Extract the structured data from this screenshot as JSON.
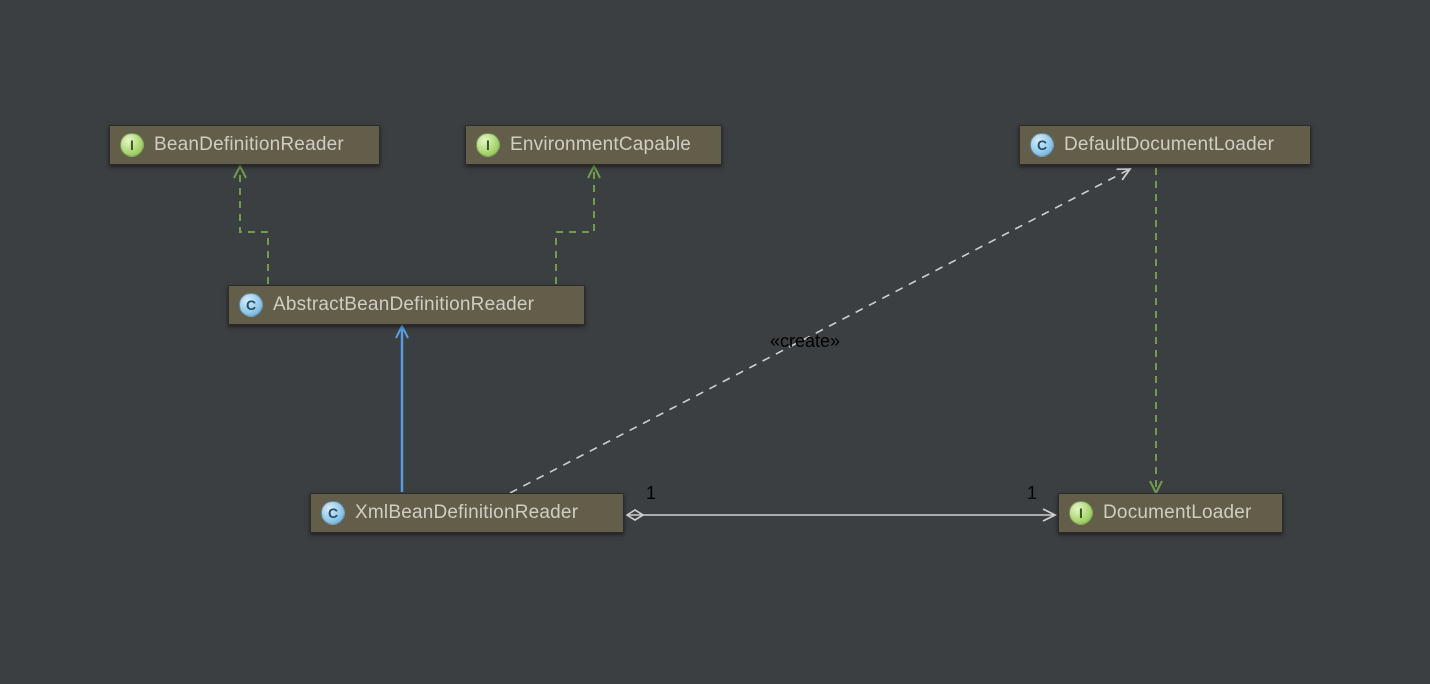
{
  "nodes": {
    "beanDefinitionReader": {
      "type": "interface",
      "label": "BeanDefinitionReader"
    },
    "environmentCapable": {
      "type": "interface",
      "label": "EnvironmentCapable"
    },
    "abstractBeanDefinitionReader": {
      "type": "class",
      "label": "AbstractBeanDefinitionReader"
    },
    "xmlBeanDefinitionReader": {
      "type": "class",
      "label": "XmlBeanDefinitionReader"
    },
    "defaultDocumentLoader": {
      "type": "class",
      "label": "DefaultDocumentLoader"
    },
    "documentLoader": {
      "type": "interface",
      "label": "DocumentLoader"
    }
  },
  "icons": {
    "interface": "I",
    "class": "C"
  },
  "relationships": {
    "create_stereotype": "«create»",
    "assoc_source_multiplicity": "1",
    "assoc_target_multiplicity": "1"
  }
}
